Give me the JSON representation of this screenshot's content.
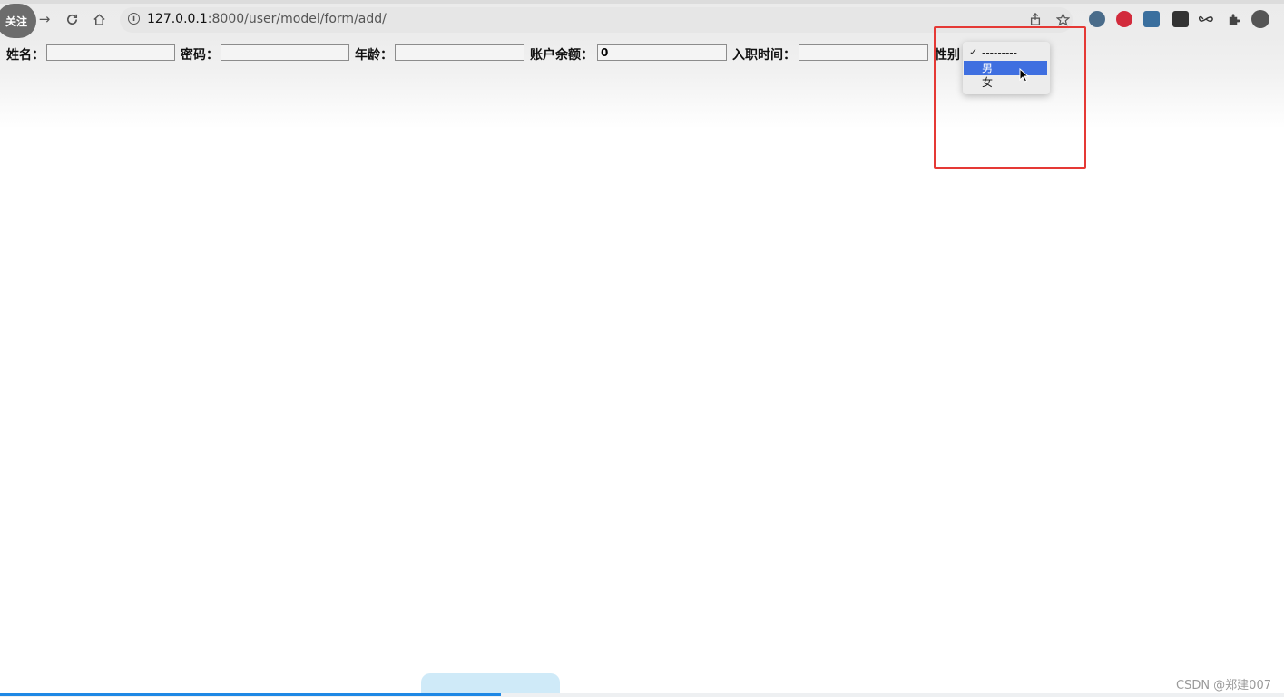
{
  "browser": {
    "follow_badge": "关注",
    "url_host": "127.0.0.1",
    "url_path": ":8000/user/model/form/add/",
    "nav": {
      "forward_icon": "→",
      "reload_icon": "C",
      "home_icon": "⌂",
      "info_icon": "i"
    }
  },
  "form": {
    "name_label": "姓名：",
    "password_label": "密码：",
    "age_label": "年龄：",
    "balance_label": "账户余额：",
    "balance_value": "0",
    "hire_label": "入职时间：",
    "gender_label": "性别"
  },
  "gender_dropdown": {
    "options": [
      {
        "check": "✓",
        "label": "---------"
      },
      {
        "check": "",
        "label": "男"
      },
      {
        "check": "",
        "label": "女"
      }
    ],
    "highlighted": "男"
  },
  "footer": {
    "watermark": "CSDN @郑建007"
  },
  "progress": 0.39,
  "colors": {
    "highlight": "#e53935",
    "selection": "#3f6fe0",
    "progress": "#1e88e5"
  }
}
